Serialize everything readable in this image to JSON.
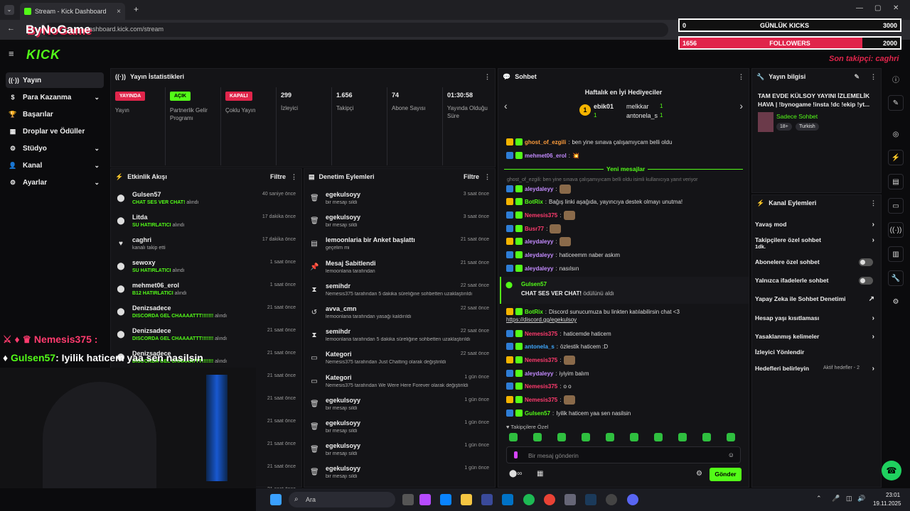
{
  "browser": {
    "tab_title": "Stream - Kick Dashboard",
    "url": "dashboard.kick.com/stream"
  },
  "kick": {
    "logo": "KICK"
  },
  "sidebar": {
    "items": [
      {
        "label": "Yayın",
        "icon": "broadcast-icon"
      },
      {
        "label": "Para Kazanma",
        "icon": "money-icon"
      },
      {
        "label": "Başarılar",
        "icon": "trophy-icon"
      },
      {
        "label": "Droplar ve Ödüller",
        "icon": "gift-icon"
      },
      {
        "label": "Stüdyo",
        "icon": "settings-icon"
      },
      {
        "label": "Kanal",
        "icon": "user-icon"
      },
      {
        "label": "Ayarlar",
        "icon": "gear-icon"
      }
    ]
  },
  "stats": {
    "title": "Yayın İstatistikleri",
    "badges": [
      {
        "badge": "YAYINDA",
        "label": "Yayın",
        "color": "#e0254b"
      },
      {
        "badge": "AÇIK",
        "label": "Partnerlik Gelir Programı",
        "color": "#53fc18"
      },
      {
        "badge": "KAPALI",
        "label": "Çoklu Yayın",
        "color": "#e0254b"
      }
    ],
    "values": [
      {
        "value": "299",
        "label": "İzleyici"
      },
      {
        "value": "1.656",
        "label": "Takipçi"
      },
      {
        "value": "74",
        "label": "Abone Sayısı"
      },
      {
        "value": "01:30:58",
        "label": "Yayında Olduğu Süre"
      }
    ]
  },
  "activity": {
    "title": "Etkinlik Akışı",
    "filter": "Filtre",
    "rows": [
      {
        "name": "Gulsen57",
        "hl": "CHAT SES VER CHAT!",
        "rest": " alındı",
        "time": "40 saniye önce",
        "icon": "redeem-icon"
      },
      {
        "name": "Litda",
        "hl": "SU HATIRLATICI",
        "rest": " alındı",
        "time": "17 dakika önce",
        "icon": "redeem-icon"
      },
      {
        "name": "caghri",
        "hl": "",
        "rest": "kanalı takip etti",
        "time": "17 dakika önce",
        "icon": "heart-icon"
      },
      {
        "name": "sewoxy",
        "hl": "SU HATIRLATICI",
        "rest": " alındı",
        "time": "1 saat önce",
        "icon": "redeem-icon"
      },
      {
        "name": "mehmet06_erol",
        "hl": "B12 HATIRLATICI",
        "rest": " alındı",
        "time": "1 saat önce",
        "icon": "redeem-icon"
      },
      {
        "name": "Denizsadece",
        "hl": "DISCORDA GEL CHAAAATTT!!!!!!!",
        "rest": " alındı",
        "time": "21 saat önce",
        "icon": "redeem-icon"
      },
      {
        "name": "Denizsadece",
        "hl": "DISCORDA GEL CHAAAATTT!!!!!!!",
        "rest": " alındı",
        "time": "21 saat önce",
        "icon": "redeem-icon"
      },
      {
        "name": "Denizsadece",
        "hl": "DISCORDA GEL CHAAAATTT!!!!!!!",
        "rest": " alındı",
        "time": "21 saat önce",
        "icon": "redeem-icon"
      }
    ],
    "extra_times": [
      "21 saat önce",
      "21 saat önce",
      "21 saat önce",
      "21 saat önce",
      "21 saat önce",
      "21 saat önce"
    ]
  },
  "moderation": {
    "title": "Denetim Eylemleri",
    "filter": "Filtre",
    "rows": [
      {
        "title": "egekulsoyy",
        "desc": "bir mesajı sildi",
        "time": "3 saat önce",
        "icon": "trash-icon"
      },
      {
        "title": "egekulsoyy",
        "desc": "bir mesajı sildi",
        "time": "3 saat önce",
        "icon": "trash-icon"
      },
      {
        "title": "lemoonlaria bir Anket başlattı",
        "desc": "geçelim mi",
        "time": "21 saat önce",
        "icon": "poll-icon"
      },
      {
        "title": "Mesaj Sabitlendi",
        "desc": "lemoonlaria tarafından",
        "time": "21 saat önce",
        "icon": "pin-icon"
      },
      {
        "title": "semihdr",
        "desc": "Nemesis375 tarafından 5 dakika süreliğine sohbetten uzaklaştırıldı",
        "time": "22 saat önce",
        "icon": "hourglass-icon"
      },
      {
        "title": "avva_cmn",
        "desc": "lemoonlaria tarafından yasağı kaldırıldı",
        "time": "22 saat önce",
        "icon": "undo-icon"
      },
      {
        "title": "semihdr",
        "desc": "lemoonlaria tarafından 5 dakika süreliğine sohbetten uzaklaştırıldı",
        "time": "22 saat önce",
        "icon": "hourglass-icon"
      },
      {
        "title": "Kategori",
        "desc": "Nemesis375 tarafından Just Chatting olarak değiştirildi",
        "time": "22 saat önce",
        "icon": "category-icon"
      },
      {
        "title": "Kategori",
        "desc": "Nemesis375 tarafından We Were Here Forever olarak değiştirildi",
        "time": "1 gün önce",
        "icon": "category-icon"
      },
      {
        "title": "egekulsoyy",
        "desc": "bir mesajı sildi",
        "time": "1 gün önce",
        "icon": "trash-icon"
      },
      {
        "title": "egekulsoyy",
        "desc": "bir mesajı sildi",
        "time": "1 gün önce",
        "icon": "trash-icon"
      },
      {
        "title": "egekulsoyy",
        "desc": "bir mesajı sildi",
        "time": "1 gün önce",
        "icon": "trash-icon"
      },
      {
        "title": "egekulsoyy",
        "desc": "bir mesajı sildi",
        "time": "1 gün önce",
        "icon": "trash-icon"
      }
    ]
  },
  "chat": {
    "title": "Sohbet",
    "gifters_title": "Haftalık en İyi Hediyeciler",
    "gifters": [
      {
        "name": "ebik01",
        "count": "1"
      },
      {
        "name": "melkkar",
        "count": "1"
      },
      {
        "name": "antonela_s",
        "count": "1"
      }
    ],
    "new_messages": "Yeni mesajlar",
    "reply_note": "ghost_of_ezgili: ben yine sınava çalışamıyıcam belli oldu isimli kullanıcıya yanıt veriyor",
    "messages": [
      {
        "user": "ghost_of_ezgili",
        "color": "#ff9d3b",
        "text": "ben yine sınava çalışamıycam belli oldu"
      },
      {
        "user": "mehmet06_erol",
        "color": "#c38bff",
        "text": "💥"
      },
      {
        "user": "aleydaleyy",
        "color": "#c38bff",
        "text": ""
      },
      {
        "user": "BotRix",
        "color": "#53fc18",
        "text": "Bağış linki aşağıda, yayıncıya destek olmayı unutma!"
      },
      {
        "user": "Nemesis375",
        "color": "#ff3b6e",
        "text": ""
      },
      {
        "user": "Busr77",
        "color": "#ff3b6e",
        "text": ""
      },
      {
        "user": "aleydaleyy",
        "color": "#c38bff",
        "text": ""
      },
      {
        "user": "aleydaleyy",
        "color": "#c38bff",
        "text": "haticeemm naber askım"
      },
      {
        "user": "aleydaleyy",
        "color": "#c38bff",
        "text": "nasılsın"
      },
      {
        "user": "BotRix",
        "color": "#53fc18",
        "text": "Discord sunucumuza bu linkten katılabilirsin chat <3"
      },
      {
        "user": "Nemesis375",
        "color": "#ff3b6e",
        "text": "haticemde haticem"
      },
      {
        "user": "antonela_s",
        "color": "#3fa9ff",
        "text": "özlestik haticem :D"
      },
      {
        "user": "Nemesis375",
        "color": "#ff3b6e",
        "text": ""
      },
      {
        "user": "aleydaleyy",
        "color": "#c38bff",
        "text": "iyiyim balım"
      },
      {
        "user": "Nemesis375",
        "color": "#ff3b6e",
        "text": "o o"
      },
      {
        "user": "Nemesis375",
        "color": "#ff3b6e",
        "text": ""
      },
      {
        "user": "Gulsen57",
        "color": "#53fc18",
        "text": "Iyilik haticem yaa sen nasilsin"
      }
    ],
    "discord_link": "https://discord.gg/egekulsoy",
    "reward_user": "Gulsen57",
    "reward_text": "CHAT SES VER CHAT!",
    "reward_rest": " ödülünü aldı",
    "followers_only": "Takipçilere Özel",
    "input_placeholder": "Bir mesaj gönderin",
    "send": "Gönder",
    "points": "∞"
  },
  "stream_info": {
    "title": "Yayın bilgisi",
    "stream_title": "TAM EVDE KÜLSOY YAYINI İZLEMELİK HAVA | !bynogame !insta !dc !ekip !yt...",
    "category": "Sadece Sohbet",
    "tags": [
      "18+",
      "Turkish"
    ]
  },
  "channel_actions": {
    "title": "Kanal Eylemleri",
    "items": [
      {
        "label": "Yavaş mod",
        "kind": "chev"
      },
      {
        "label": "Takipçilere özel sohbet",
        "sub": "1dk.",
        "kind": "chev"
      },
      {
        "label": "Abonelere özel sohbet",
        "kind": "toggle"
      },
      {
        "label": "Yalnızca ifadelerle sohbet",
        "kind": "toggle"
      },
      {
        "label": "Yapay Zeka ile Sohbet Denetimi",
        "kind": "ext"
      },
      {
        "label": "Hesap yaşı kısıtlaması",
        "kind": "chev"
      },
      {
        "label": "Yasaklanmış kelimeler",
        "kind": "chev"
      },
      {
        "label": "İzleyici Yönlendir",
        "kind": "none"
      },
      {
        "label": "Hedefleri belirleyin",
        "sub": "Aktif hedefler - 2",
        "kind": "chev"
      }
    ]
  },
  "overlay": {
    "brand": "ByNoGame",
    "daily_kicks_label": "GÜNLÜK KICKS",
    "daily_kicks_value": "0",
    "daily_kicks_goal": "3000",
    "followers_label": "FOLLOWERS",
    "followers_value": "1656",
    "followers_goal": "2000",
    "followers_progress": 0.828,
    "last_follower": "Son takipçi: caghri",
    "chat_line1_user": "Nemesis375",
    "chat_line2_user": "Gulsen57",
    "chat_line2_text": ": Iyilik haticem yaa sen nasilsin"
  },
  "taskbar": {
    "search": "Ara",
    "time": "23:01",
    "date": "19.11.2025"
  },
  "colors": {
    "accent": "#53fc18",
    "live": "#e0254b",
    "panel": "#141417"
  }
}
